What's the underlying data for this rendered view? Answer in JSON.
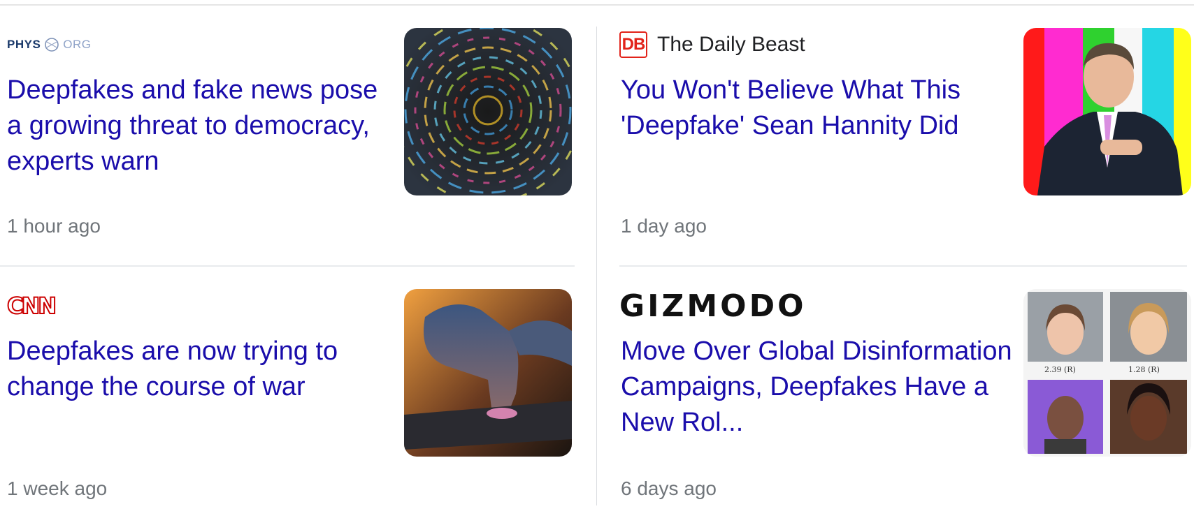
{
  "cards": [
    {
      "source": "PHYS.ORG",
      "source_logo_text": "PHYS",
      "source_logo_suffix": "ORG",
      "headline": "Deepfakes and fake news pose a growing threat to democracy, experts warn",
      "time": "1 hour ago",
      "thumb_icon": "abstract-swirl-image"
    },
    {
      "source": "The Daily Beast",
      "source_logo_text": "DB",
      "headline": "You Won't Believe What This 'Deepfake' Sean Hannity Did",
      "time": "1 day ago",
      "thumb_icon": "man-in-suit-photo"
    },
    {
      "source": "CNN",
      "source_logo_text": "CNN",
      "headline": "Deepfakes are now trying to change the course of war",
      "time": "1 week ago",
      "thumb_icon": "finger-touching-phone-photo"
    },
    {
      "source": "GIZMODO",
      "source_logo_text": "GIZMODO",
      "headline": "Move Over Global Disinformation Campaigns, Deepfakes Have a New Rol...",
      "time": "6 days ago",
      "thumb_icon": "faces-grid-photo",
      "thumb_labels": [
        "2.39 (R)",
        "1.28 (R)"
      ]
    }
  ],
  "colors": {
    "headline": "#1a0dab",
    "time": "#70757a",
    "cnn_red": "#cc0000",
    "db_red": "#e2231a"
  }
}
